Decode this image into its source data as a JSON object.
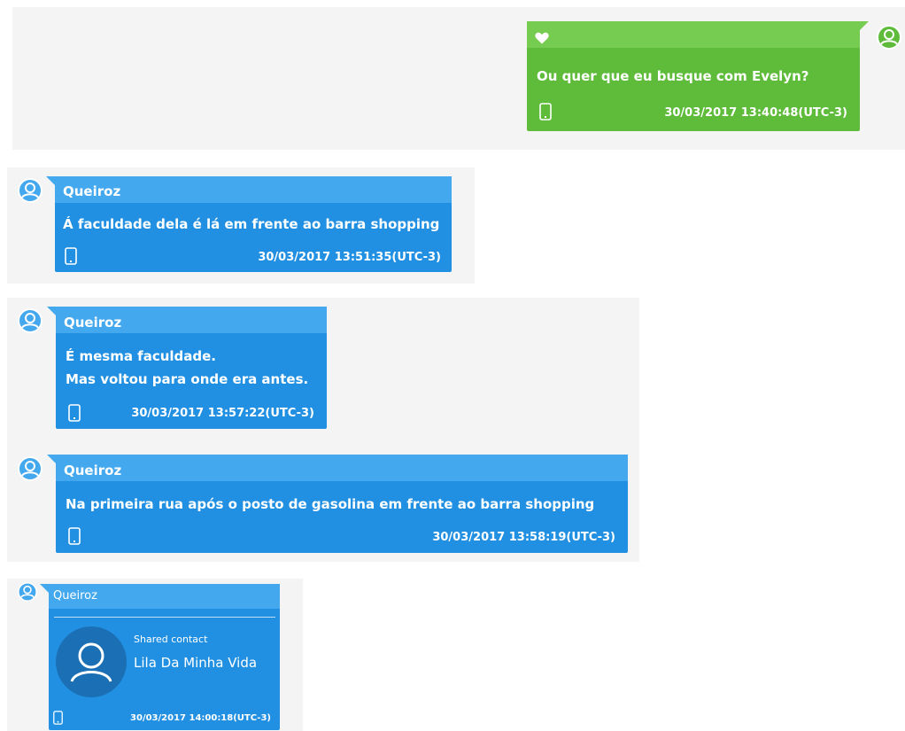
{
  "colors": {
    "panel_bg": "#f4f4f4",
    "incoming_bubble": "#2290e2",
    "incoming_header": "#44a8ee",
    "outgoing_bubble": "#5fbc3b",
    "outgoing_header": "#76cc50",
    "avatar_circle": "#1b6fb4"
  },
  "messages": [
    {
      "direction": "outgoing",
      "icon": "heart-icon",
      "text": "Ou quer que eu busque com Evelyn?",
      "timestamp": "30/03/2017 13:40:48(UTC-3)",
      "source_icon": "phone-icon"
    },
    {
      "direction": "incoming",
      "sender": "Queiroz",
      "text": "Á faculdade dela é lá em frente ao barra shopping",
      "timestamp": "30/03/2017 13:51:35(UTC-3)",
      "source_icon": "phone-icon"
    },
    {
      "direction": "incoming",
      "sender": "Queiroz",
      "lines": [
        "É  mesma faculdade.",
        "Mas voltou para onde era antes."
      ],
      "timestamp": "30/03/2017 13:57:22(UTC-3)",
      "source_icon": "phone-icon"
    },
    {
      "direction": "incoming",
      "sender": "Queiroz",
      "text": "Na primeira rua após o posto de gasolina em frente ao barra shopping",
      "timestamp": "30/03/2017 13:58:19(UTC-3)",
      "source_icon": "phone-icon"
    },
    {
      "direction": "incoming",
      "sender": "Queiroz",
      "shared_contact": {
        "label": "Shared contact",
        "name": "Lila Da Minha Vida",
        "avatar_icon": "person-silhouette-icon"
      },
      "timestamp": "30/03/2017 14:00:18(UTC-3)",
      "source_icon": "phone-icon"
    }
  ]
}
